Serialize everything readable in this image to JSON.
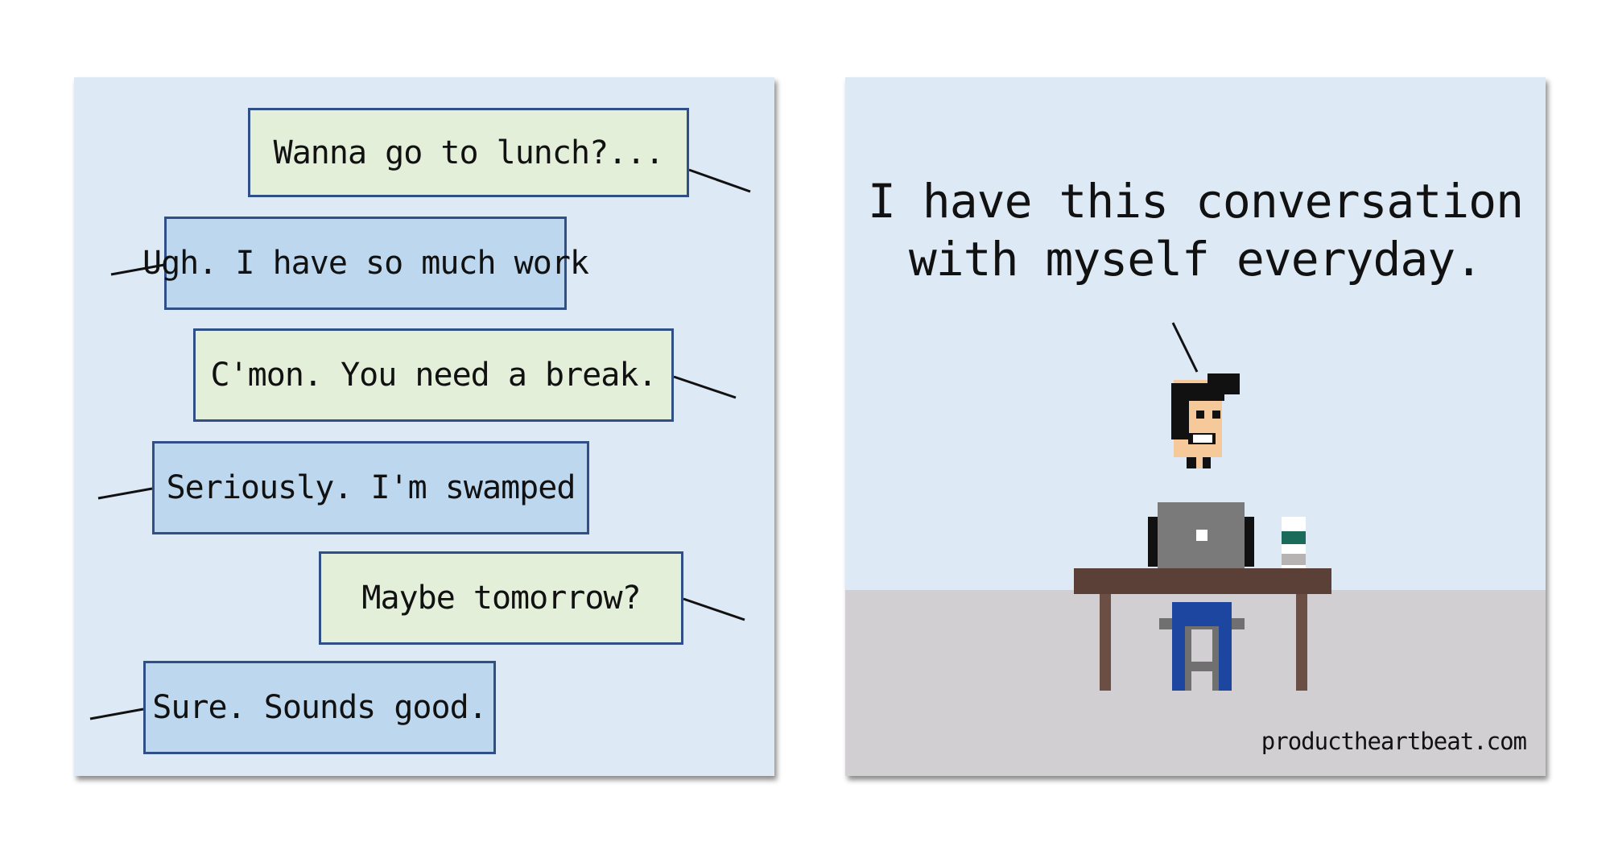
{
  "left_panel": {
    "bubbles": [
      {
        "text": "Wanna go to lunch?..."
      },
      {
        "text": "Ugh. I have so much work"
      },
      {
        "text": "C'mon. You need a break."
      },
      {
        "text": "Seriously. I'm swamped"
      },
      {
        "text": "Maybe tomorrow?"
      },
      {
        "text": "Sure. Sounds good."
      }
    ]
  },
  "right_panel": {
    "caption": "I have this conversation\nwith myself everyday.",
    "website": "productheartbeat.com"
  },
  "colors": {
    "panel_bg": "#dde9f5",
    "bubble_green": "#e3efd9",
    "bubble_blue": "#bcd7ee",
    "bubble_border": "#2f4f86",
    "floor": "#d1cfd1",
    "desk": "#5b4038",
    "laptop": "#7a7a7a",
    "skin": "#f5c99a",
    "hair": "#111111",
    "pants": "#1d46a0",
    "cup_band": "#1b6b5a"
  }
}
